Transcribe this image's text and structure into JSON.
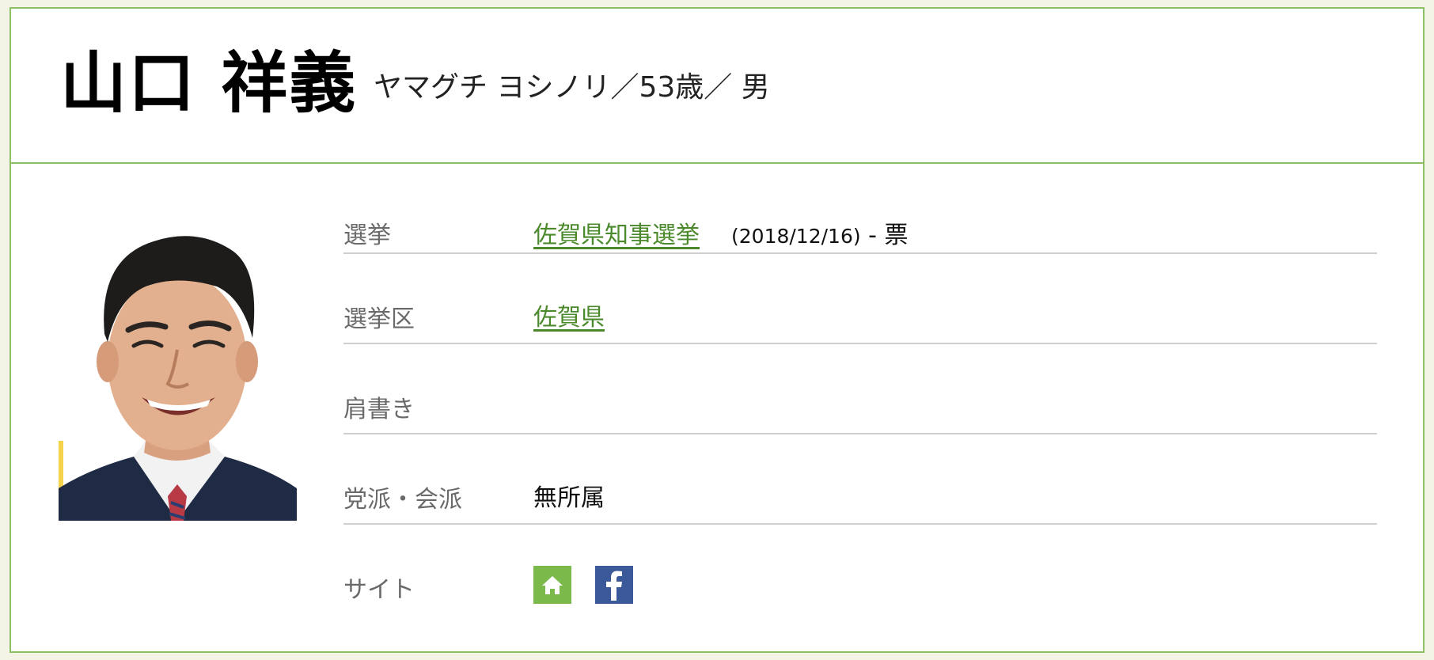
{
  "candidate": {
    "name": "山口 祥義",
    "info": "ヤマグチ ヨシノリ／53歳／ 男"
  },
  "details": {
    "election": {
      "label": "選挙",
      "link_text": "佐賀県知事選挙",
      "date": "(2018/12/16)",
      "votes": " - 票"
    },
    "district": {
      "label": "選挙区",
      "link_text": "佐賀県"
    },
    "title": {
      "label": "肩書き",
      "value": ""
    },
    "party": {
      "label": "党派・会派",
      "value": "無所属"
    },
    "site": {
      "label": "サイト",
      "icons": [
        "home-icon",
        "facebook-icon"
      ]
    }
  },
  "colors": {
    "accent": "#8cc063",
    "link": "#4b8a2c",
    "home_button": "#7bb94a",
    "facebook_button": "#3b5998",
    "page_background": "#f3f3e6"
  }
}
